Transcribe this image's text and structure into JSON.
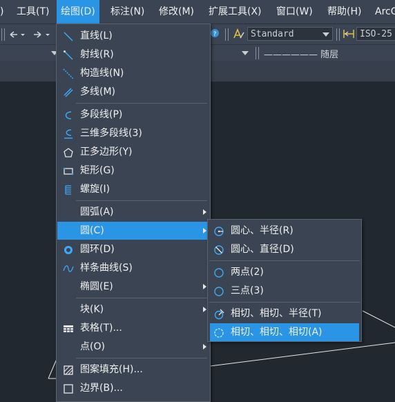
{
  "menubar": {
    "items": [
      {
        "label": ")"
      },
      {
        "label": "工具(T)"
      },
      {
        "label": "绘图(D)"
      },
      {
        "label": "标注(N)"
      },
      {
        "label": "修改(M)"
      },
      {
        "label": "扩展工具(X)"
      },
      {
        "label": "窗口(W)"
      },
      {
        "label": "帮助(H)"
      },
      {
        "label": "ArcG"
      }
    ]
  },
  "toolbar": {
    "text_style": "Standard",
    "dim_style": "ISO-25",
    "linetype_value": "—————— 随层"
  },
  "draw_menu": {
    "items": [
      {
        "label": "直线(L)",
        "icon": "line-icon"
      },
      {
        "label": "射线(R)",
        "icon": "ray-icon"
      },
      {
        "label": "构造线(N)",
        "icon": "xline-icon"
      },
      {
        "label": "多线(M)",
        "icon": "multiline-icon"
      },
      {
        "label": "多段线(P)",
        "icon": "polyline-icon"
      },
      {
        "label": "三维多段线(3)",
        "icon": "3d-polyline-icon"
      },
      {
        "label": "正多边形(Y)",
        "icon": "polygon-icon"
      },
      {
        "label": "矩形(G)",
        "icon": "rectangle-icon"
      },
      {
        "label": "螺旋(I)",
        "icon": "helix-icon"
      },
      {
        "label": "圆弧(A)",
        "icon": ""
      },
      {
        "label": "圆(C)",
        "icon": ""
      },
      {
        "label": "圆环(D)",
        "icon": "donut-icon"
      },
      {
        "label": "样条曲线(S)",
        "icon": "spline-icon"
      },
      {
        "label": "椭圆(E)",
        "icon": ""
      },
      {
        "label": "块(K)",
        "icon": ""
      },
      {
        "label": "表格(T)...",
        "icon": "table-icon"
      },
      {
        "label": "点(O)",
        "icon": ""
      },
      {
        "label": "图案填充(H)...",
        "icon": "hatch-icon"
      },
      {
        "label": "边界(B)...",
        "icon": "boundary-icon"
      }
    ]
  },
  "circle_submenu": {
    "items": [
      {
        "label": "圆心、半径(R)",
        "icon": "circle-center-radius-icon"
      },
      {
        "label": "圆心、直径(D)",
        "icon": "circle-center-diameter-icon"
      },
      {
        "label": "两点(2)",
        "icon": "circle-2point-icon"
      },
      {
        "label": "三点(3)",
        "icon": "circle-3point-icon"
      },
      {
        "label": "相切、相切、半径(T)",
        "icon": "circle-ttr-icon"
      },
      {
        "label": "相切、相切、相切(A)",
        "icon": "circle-ttt-icon"
      }
    ]
  },
  "colors": {
    "accent": "#2a95e5",
    "menu_bg": "#3b4452",
    "canvas_bg": "#212830"
  }
}
